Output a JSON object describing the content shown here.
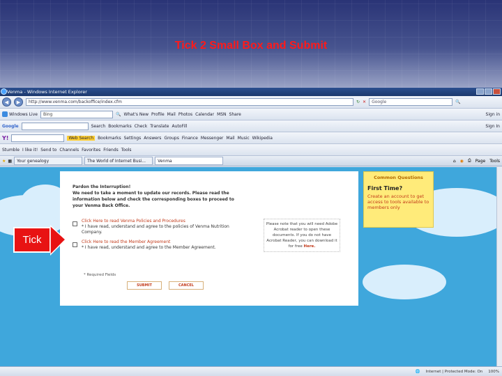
{
  "slide": {
    "title": "Tick 2 Small Box and Submit"
  },
  "annotation": {
    "label": "Tick",
    "color": "#e81313"
  },
  "window": {
    "title": "Venma - Windows Internet Explorer"
  },
  "addressbar": {
    "url": "http://www.venma.com/backoffice/index.cfm",
    "search_engine": "Google"
  },
  "toolbar1": {
    "brand": "Windows Live",
    "search_value": "Bing",
    "items": [
      "What's New",
      "Profile",
      "Mail",
      "Photos",
      "Calendar",
      "MSN",
      "Share"
    ],
    "signin": "Sign in"
  },
  "toolbar2": {
    "brand": "Google",
    "items": [
      "Search",
      "Bookmarks",
      "Check",
      "Translate",
      "AutoFill"
    ],
    "signin": "Sign In"
  },
  "toolbar3": {
    "items": [
      "Web Search",
      "Bookmarks",
      "Settings",
      "Answers",
      "Groups",
      "Finance",
      "Messenger",
      "Mail",
      "Music",
      "Wikipedia"
    ]
  },
  "toolbar4": {
    "items": [
      "Stumble",
      "I like it!",
      "Send to",
      "Channels",
      "Favorites",
      "Friends",
      "Tools"
    ]
  },
  "tabs": {
    "items": [
      {
        "label": "Your genealogy",
        "active": false
      },
      {
        "label": "The World of Internet Busi...",
        "active": false
      },
      {
        "label": "Venma",
        "active": true
      }
    ],
    "right": [
      "Page",
      "Tools"
    ]
  },
  "form": {
    "intro_lines": [
      "Pardon the Interruption!",
      "We need to take a moment to update our records. Please read the",
      "information below and check the corresponding boxes to proceed to",
      "your Venma Back Office."
    ],
    "row1_link": "Click Here to read Venma Policies and Procedures",
    "row1_text": "* I have read, understand and agree to the policies of Venma Nutrition Company.",
    "row2_link": "Click Here to read the Member Agreement",
    "row2_text": "* I have read, understand and agree to the Member Agreement.",
    "note_text": "Please note that you will need Adobe Acrobat reader to open these documents. If you do not have Acrobat Reader, you can download it for free",
    "note_link": "Here.",
    "required": "* Required Fields",
    "submit_label": "SUBMIT",
    "cancel_label": "CANCEL"
  },
  "faq": {
    "heading": "Common Questions",
    "question": "First Time?",
    "answer": "Create an account to get access to tools available to members only"
  },
  "statusbar": {
    "zone": "Internet | Protected Mode: On",
    "zoom": "100%"
  }
}
